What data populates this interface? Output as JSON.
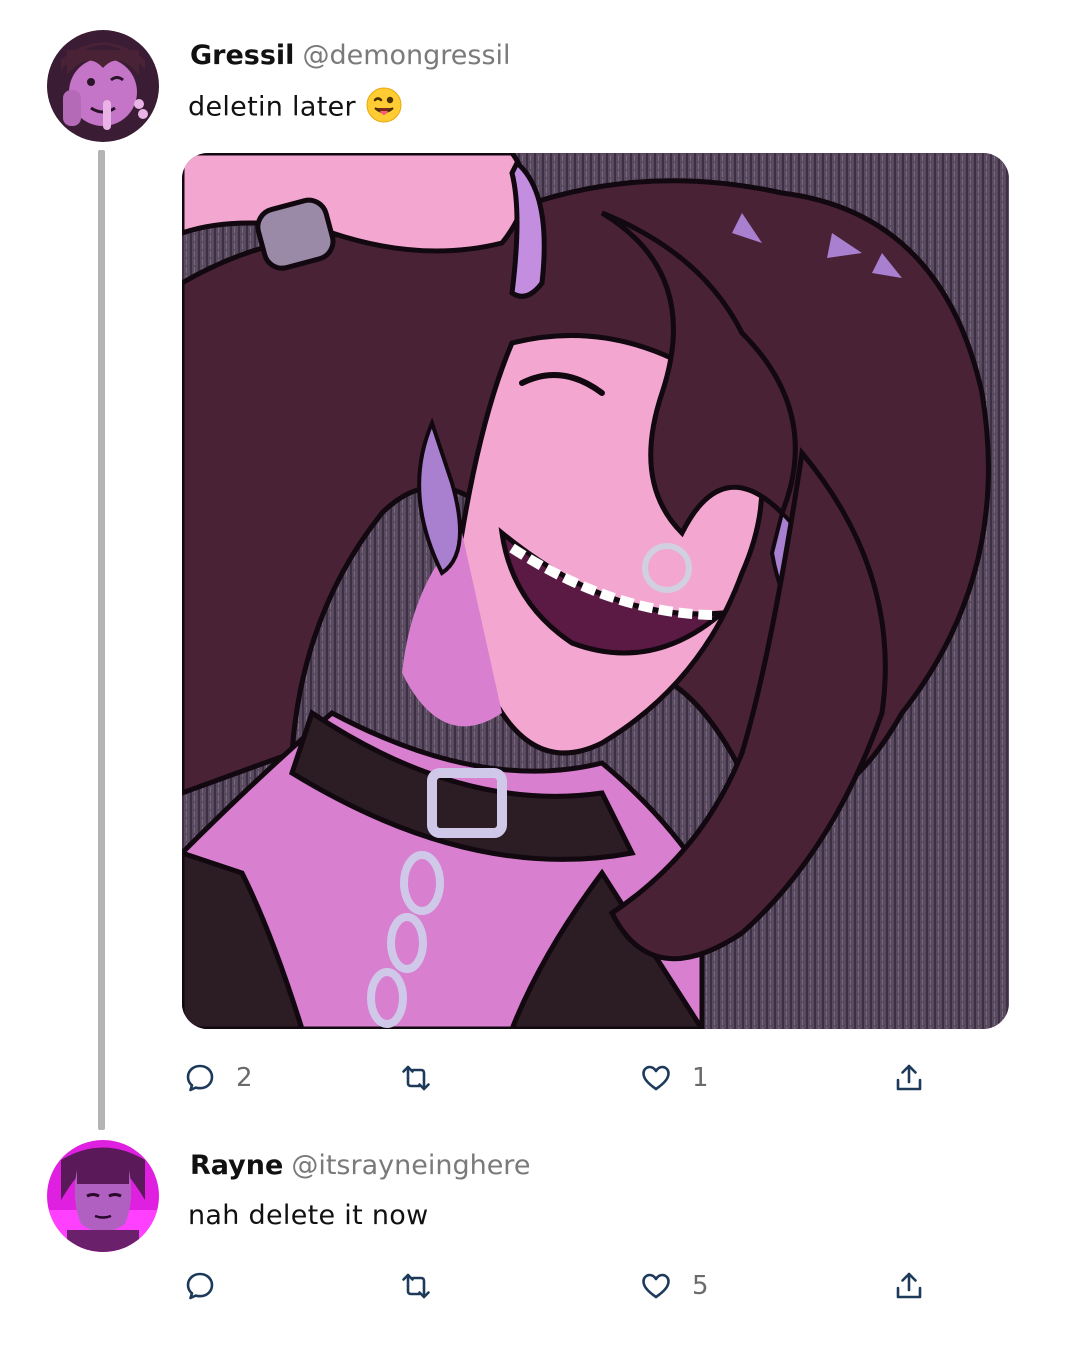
{
  "thread": [
    {
      "author": {
        "name": "Gressil",
        "handle": "@demongressil"
      },
      "text": "deletin later",
      "emoji": "winking-face-with-tongue",
      "has_media": true,
      "actions": {
        "replies": "2",
        "retweets": "",
        "likes": "1"
      }
    },
    {
      "author": {
        "name": "Rayne",
        "handle": "@itsrayneinghere"
      },
      "text": "nah delete it now",
      "has_media": false,
      "actions": {
        "replies": "",
        "retweets": "",
        "likes": "5"
      }
    }
  ],
  "colors": {
    "thread_line": "#b4b4b4",
    "handle": "#7a7a7a",
    "icon": "#1d3a5a",
    "count": "#6b6b6b",
    "skin": "#f3a6cf",
    "hair": "#4a2236",
    "shade": "#d87fd0",
    "accent_purple": "#a97fd0"
  },
  "icons": [
    "reply-icon",
    "retweet-icon",
    "like-icon",
    "share-icon"
  ]
}
